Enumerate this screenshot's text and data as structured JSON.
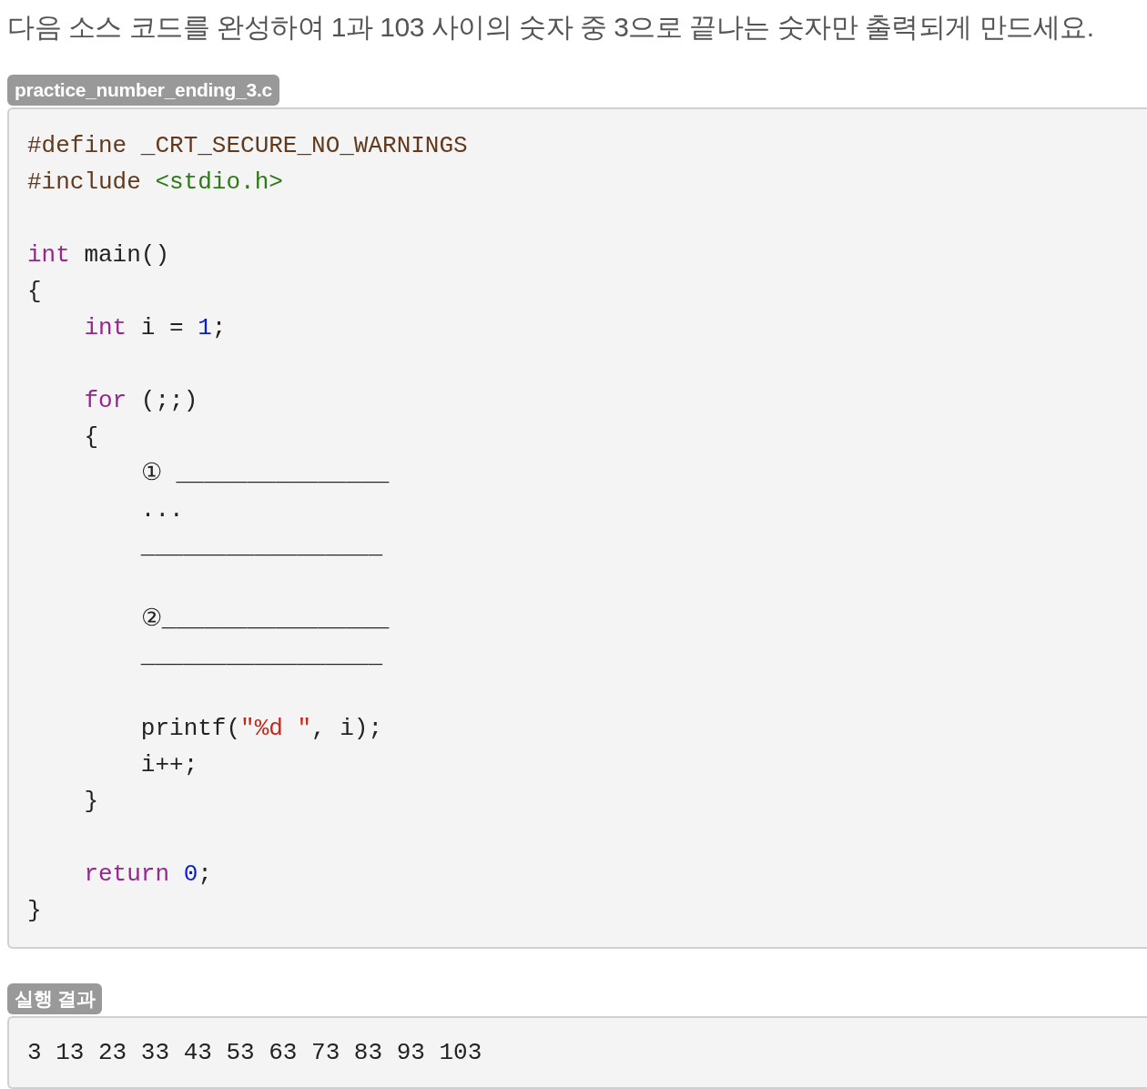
{
  "question": "다음 소스 코드를 완성하여 1과 103 사이의 숫자 중 3으로 끝나는 숫자만 출력되게 만드세요.",
  "source": {
    "label": "practice_number_ending_3.c",
    "lines": [
      {
        "kind": "code",
        "tokens": [
          {
            "kind": "preprocessor",
            "text": "#define _CRT_SECURE_NO_WARNINGS"
          }
        ]
      },
      {
        "kind": "code",
        "tokens": [
          {
            "kind": "preprocessor",
            "text": "#include "
          },
          {
            "kind": "header",
            "text": "<stdio.h>"
          }
        ]
      },
      {
        "kind": "blank"
      },
      {
        "kind": "code",
        "tokens": [
          {
            "kind": "keyword",
            "text": "int"
          },
          {
            "kind": "plain",
            "text": " main()"
          }
        ]
      },
      {
        "kind": "code",
        "tokens": [
          {
            "kind": "plain",
            "text": "{"
          }
        ]
      },
      {
        "kind": "code",
        "tokens": [
          {
            "kind": "keyword",
            "text": "    int"
          },
          {
            "kind": "plain",
            "text": " i = "
          },
          {
            "kind": "number",
            "text": "1"
          },
          {
            "kind": "plain",
            "text": ";"
          }
        ]
      },
      {
        "kind": "blank"
      },
      {
        "kind": "code",
        "tokens": [
          {
            "kind": "keyword",
            "text": "    for"
          },
          {
            "kind": "plain",
            "text": " (;;)"
          }
        ]
      },
      {
        "kind": "code",
        "tokens": [
          {
            "kind": "plain",
            "text": "    {"
          }
        ]
      },
      {
        "kind": "code",
        "tokens": [
          {
            "kind": "plain",
            "text": "        ① _______________"
          }
        ]
      },
      {
        "kind": "code",
        "tokens": [
          {
            "kind": "plain",
            "text": "        ..."
          }
        ]
      },
      {
        "kind": "code",
        "tokens": [
          {
            "kind": "plain",
            "text": "        _________________"
          }
        ]
      },
      {
        "kind": "blank"
      },
      {
        "kind": "code",
        "tokens": [
          {
            "kind": "plain",
            "text": "        ②________________"
          }
        ]
      },
      {
        "kind": "code",
        "tokens": [
          {
            "kind": "plain",
            "text": "        _________________"
          }
        ]
      },
      {
        "kind": "blank"
      },
      {
        "kind": "code",
        "tokens": [
          {
            "kind": "plain",
            "text": "        printf("
          },
          {
            "kind": "string",
            "text": "\"%d \""
          },
          {
            "kind": "plain",
            "text": ", i);"
          }
        ]
      },
      {
        "kind": "code",
        "tokens": [
          {
            "kind": "plain",
            "text": "        i++;"
          }
        ]
      },
      {
        "kind": "code",
        "tokens": [
          {
            "kind": "plain",
            "text": "    }"
          }
        ]
      },
      {
        "kind": "blank"
      },
      {
        "kind": "code",
        "tokens": [
          {
            "kind": "keyword",
            "text": "    return"
          },
          {
            "kind": "number",
            "text": " 0"
          },
          {
            "kind": "plain",
            "text": ";"
          }
        ]
      },
      {
        "kind": "code",
        "tokens": [
          {
            "kind": "plain",
            "text": "}"
          }
        ]
      }
    ]
  },
  "result": {
    "label": "실행 결과",
    "output": "3 13 23 33 43 53 63 73 83 93 103"
  }
}
